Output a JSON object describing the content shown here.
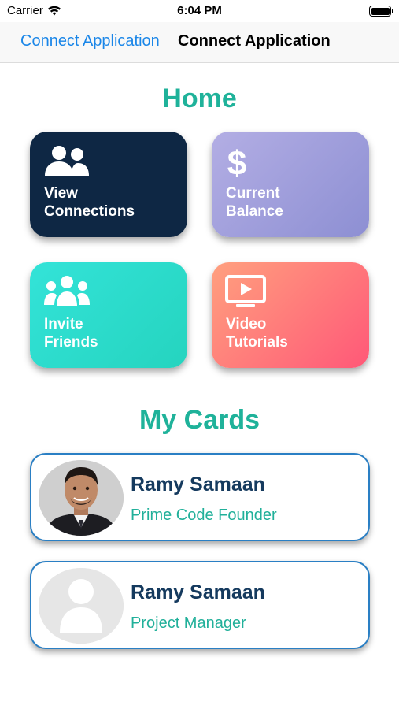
{
  "status_bar": {
    "carrier": "Carrier",
    "time": "6:04 PM",
    "battery_level": 1.0,
    "icons": [
      "wifi-icon",
      "battery-icon"
    ]
  },
  "nav": {
    "back_label": "Connect Application",
    "title": "Connect Application"
  },
  "home": {
    "title": "Home",
    "tiles": [
      {
        "line1": "View",
        "line2": "Connections",
        "icon": "users-icon",
        "color": "#0e2744"
      },
      {
        "line1": "Current",
        "line2": "Balance",
        "icon": "dollar-icon",
        "color": "#a4a2de"
      },
      {
        "line1": "Invite",
        "line2": "Friends",
        "icon": "group-icon",
        "color": "#2adcca"
      },
      {
        "line1": "Video",
        "line2": "Tutorials",
        "icon": "video-play-icon",
        "color": "#ff7b7a"
      }
    ]
  },
  "my_cards": {
    "title": "My Cards",
    "cards": [
      {
        "name": "Ramy Samaan",
        "role": "Prime Code Founder",
        "avatar": "profile-photo"
      },
      {
        "name": "Ramy Samaan",
        "role": "Project Manager",
        "avatar": "avatar-placeholder-icon"
      }
    ]
  },
  "colors": {
    "accent_teal": "#1fb29a",
    "nav_link_blue": "#1a86e8",
    "card_border": "#2a7fc4",
    "name_navy": "#153a5e"
  }
}
